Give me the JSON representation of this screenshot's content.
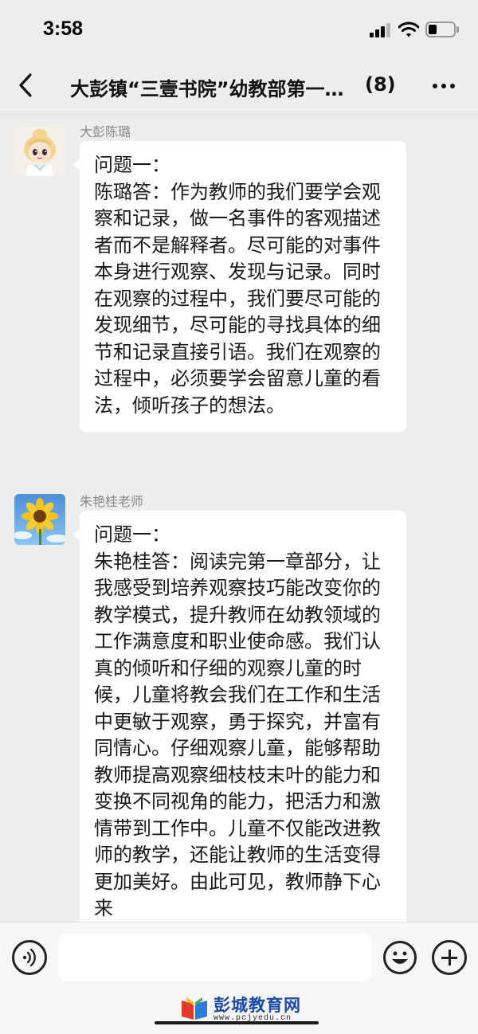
{
  "status_bar": {
    "time": "3:58",
    "icons": [
      "signal-icon",
      "wifi-icon",
      "battery-icon"
    ]
  },
  "nav": {
    "title": "大彭镇“三壹书院”幼教部第一读书小组",
    "member_count": "(8)",
    "back_icon": "chevron-left-icon",
    "more_icon": "more-icon"
  },
  "messages": [
    {
      "sender": "大彭陈璐",
      "avatar_icon": "cartoon-girl-avatar",
      "text": "问题一：\n陈璐答：作为教师的我们要学会观察和记录，做一名事件的客观描述者而不是解释者。尽可能的对事件本身进行观察、发现与记录。同时在观察的过程中，我们要尽可能的发现细节，尽可能的寻找具体的细节和记录直接引语。我们在观察的过程中，必须要学会留意儿童的看法，倾听孩子的想法。"
    },
    {
      "sender": "朱艳桂老师",
      "avatar_icon": "sunflower-avatar",
      "text": "问题一：\n朱艳桂答：阅读完第一章部分，让我感受到培养观察技巧能改变你的教学模式，提升教师在幼教领域的工作满意度和职业使命感。我们认真的倾听和仔细的观察儿童的时候，儿童将教会我们在工作和生活中更敏于观察，勇于探究，并富有同情心。仔细观察儿童，能够帮助教师提高观察细枝枝末叶的能力和变换不同视角的能力，把活力和激情带到工作中。儿童不仅能改进教师的教学，还能让教师的生活变得更加美好。由此可见，教师静下心来"
    }
  ],
  "input_bar": {
    "voice_icon": "voice-icon",
    "emoji_icon": "emoji-icon",
    "plus_icon": "plus-icon",
    "input_value": ""
  },
  "watermark": {
    "name": "彭城教育网",
    "url": "www.pcjyedu.cn"
  },
  "colors": {
    "background": "#ededed",
    "bubble": "#ffffff",
    "name_gray": "#888888",
    "watermark_blue": "#1a4aa8"
  }
}
